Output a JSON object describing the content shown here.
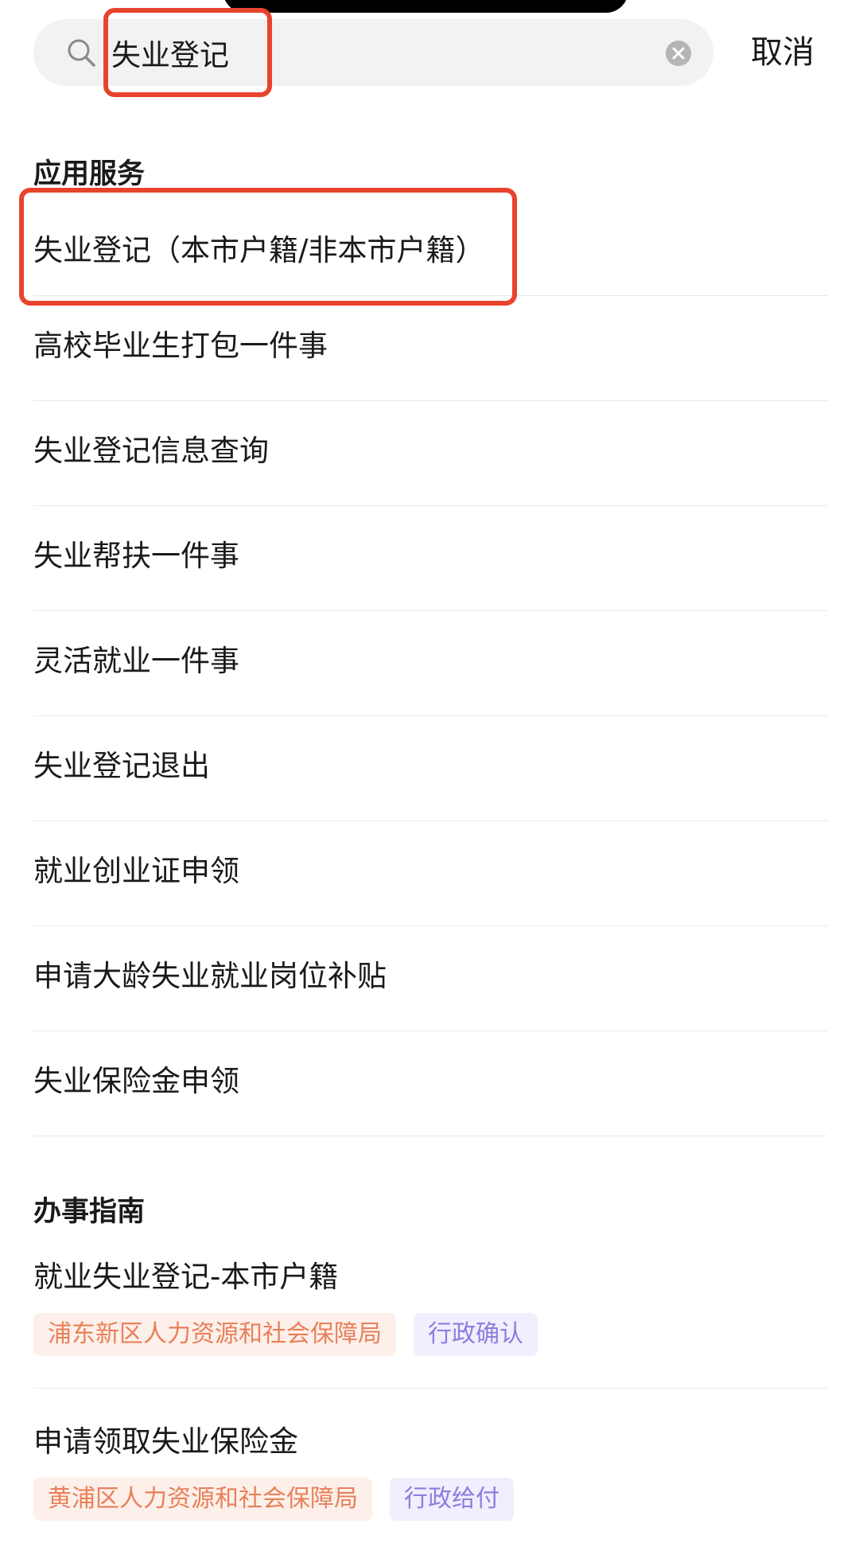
{
  "search": {
    "value": "失业登记",
    "cancel_label": "取消"
  },
  "services": {
    "title": "应用服务",
    "items": [
      {
        "label": "失业登记（本市户籍/非本市户籍）"
      },
      {
        "label": "高校毕业生打包一件事"
      },
      {
        "label": "失业登记信息查询"
      },
      {
        "label": "失业帮扶一件事"
      },
      {
        "label": "灵活就业一件事"
      },
      {
        "label": "失业登记退出"
      },
      {
        "label": "就业创业证申领"
      },
      {
        "label": "申请大龄失业就业岗位补贴"
      },
      {
        "label": "失业保险金申领"
      }
    ]
  },
  "guides": {
    "title": "办事指南",
    "items": [
      {
        "title": "就业失业登记-本市户籍",
        "department": "浦东新区人力资源和社会保障局",
        "type": "行政确认"
      },
      {
        "title": "申请领取失业保险金",
        "department": "黄浦区人力资源和社会保障局",
        "type": "行政给付"
      }
    ]
  },
  "colors": {
    "highlight": "#e8432d",
    "dept_tag": "#e8805a",
    "type_tag": "#8b7ee0"
  },
  "icons": {
    "search": "search-icon",
    "clear": "clear-icon"
  }
}
